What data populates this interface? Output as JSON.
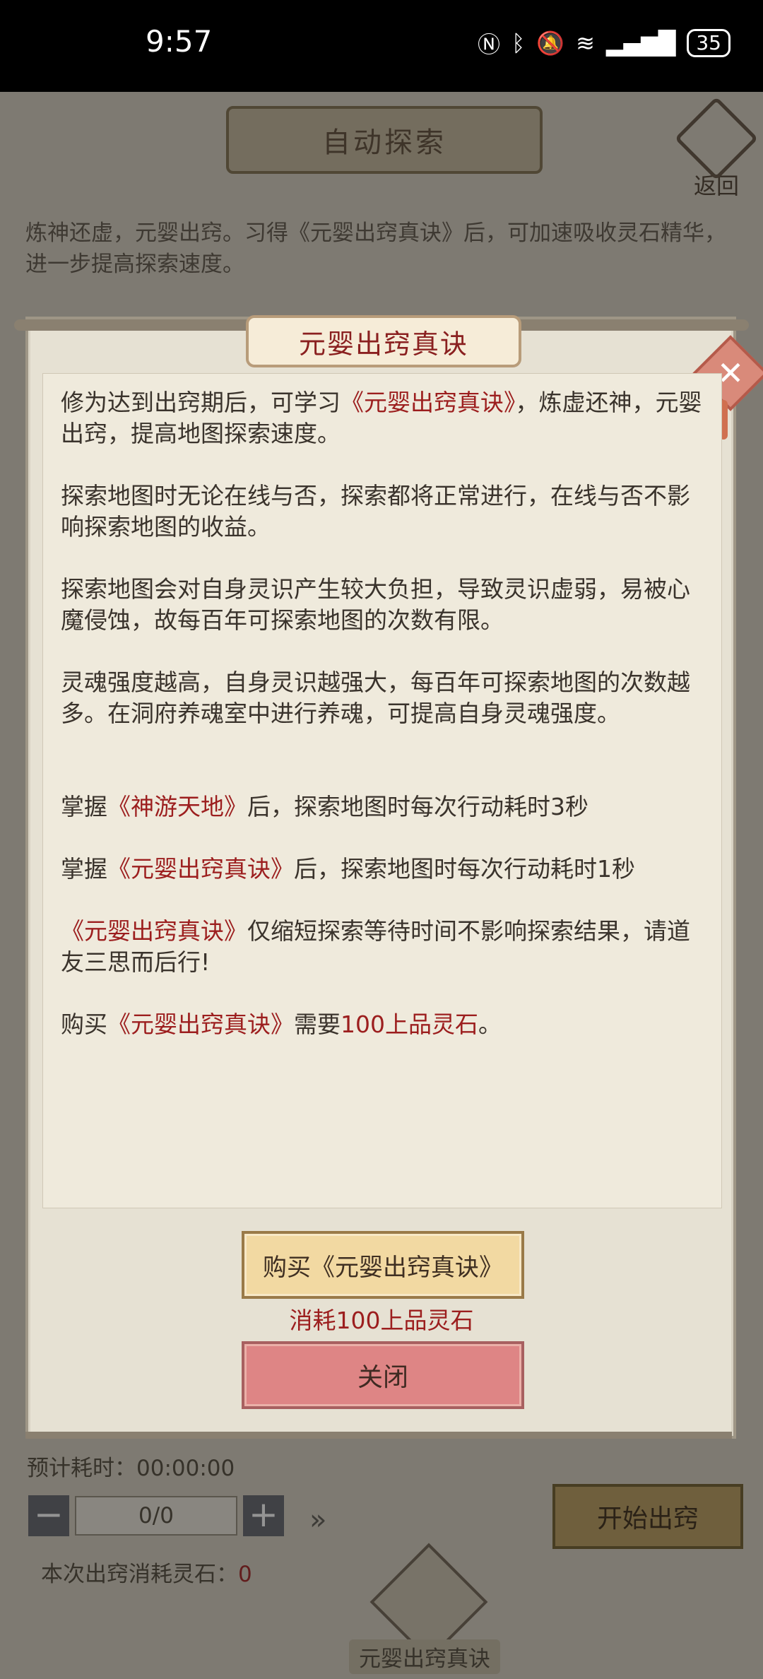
{
  "status_bar": {
    "time": "9:57",
    "battery": "35",
    "icons": [
      "nfc-icon",
      "bluetooth-icon",
      "mute-icon",
      "wifi-icon",
      "5g-signal-icon",
      "battery-icon"
    ]
  },
  "background": {
    "title": "自动探索",
    "back_label": "返回",
    "intro": "炼神还虚，元婴出窍。习得《元婴出窍真诀》后，可加速吸收灵石精华，进一步提高探索速度。",
    "estimate_label": "预计耗时：00:00:00",
    "stepper_value": "0/0",
    "start_button": "开始出窍",
    "cost_label": "本次出窍消耗灵石：",
    "cost_value": "0",
    "skill_label": "元婴出窍真诀"
  },
  "modal": {
    "title": "元婴出窍真诀",
    "paragraphs": [
      {
        "pre": "修为达到出窍期后，可学习",
        "hl": "《元婴出窍真诀》",
        "post": "，炼虚还神，元婴出窍，提高地图探索速度。"
      },
      {
        "pre": "探索地图时无论在线与否，探索都将正常进行，在线与否不影响探索地图的收益。",
        "hl": "",
        "post": ""
      },
      {
        "pre": "探索地图会对自身灵识产生较大负担，导致灵识虚弱，易被心魔侵蚀，故每百年可探索地图的次数有限。",
        "hl": "",
        "post": ""
      },
      {
        "pre": "灵魂强度越高，自身灵识越强大，每百年可探索地图的次数越多。在洞府养魂室中进行养魂，可提高自身灵魂强度。",
        "hl": "",
        "post": ""
      },
      {
        "pre": "掌握",
        "hl": "《神游天地》",
        "post": "后，探索地图时每次行动耗时3秒"
      },
      {
        "pre": "掌握",
        "hl": "《元婴出窍真诀》",
        "post": "后，探索地图时每次行动耗时1秒"
      },
      {
        "pre": "",
        "hl": "《元婴出窍真诀》",
        "post": "仅缩短探索等待时间不影响探索结果，请道友三思而后行!"
      },
      {
        "pre": "购买",
        "hl": "《元婴出窍真诀》",
        "post": "需要",
        "hl2": "100上品灵石",
        "post2": "。"
      }
    ],
    "buy_button": "购买《元婴出窍真诀》",
    "consume_text": "消耗100上品灵石",
    "close_button": "关闭"
  }
}
